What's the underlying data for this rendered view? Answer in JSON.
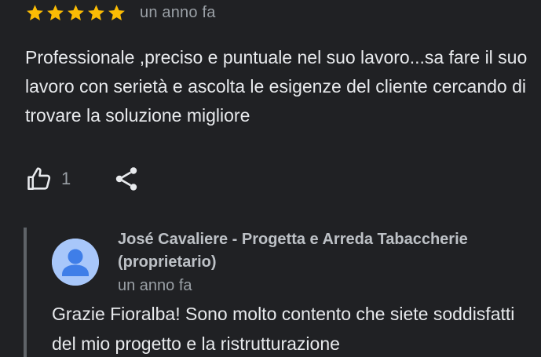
{
  "review": {
    "rating": 5,
    "rating_max": 5,
    "star_color": "#fbbc04",
    "time_ago": "un anno fa",
    "text": "Professionale ,preciso e puntuale nel suo lavoro...sa fare il suo lavoro con serietà e ascolta le esigenze del cliente cercando di trovare la soluzione migliore",
    "like_icon": "thumbs-up-icon",
    "like_count": "1",
    "share_icon": "share-icon"
  },
  "owner_reply": {
    "avatar_icon": "person-icon",
    "avatar_color": "#a8c7fa",
    "name": "José Cavaliere - Progetta e Arreda Tabaccherie (proprietario)",
    "time_ago": "un anno fa",
    "text": "Grazie Fioralba! Sono molto contento che siete soddisfatti del mio progetto e la ristrutturazione"
  }
}
